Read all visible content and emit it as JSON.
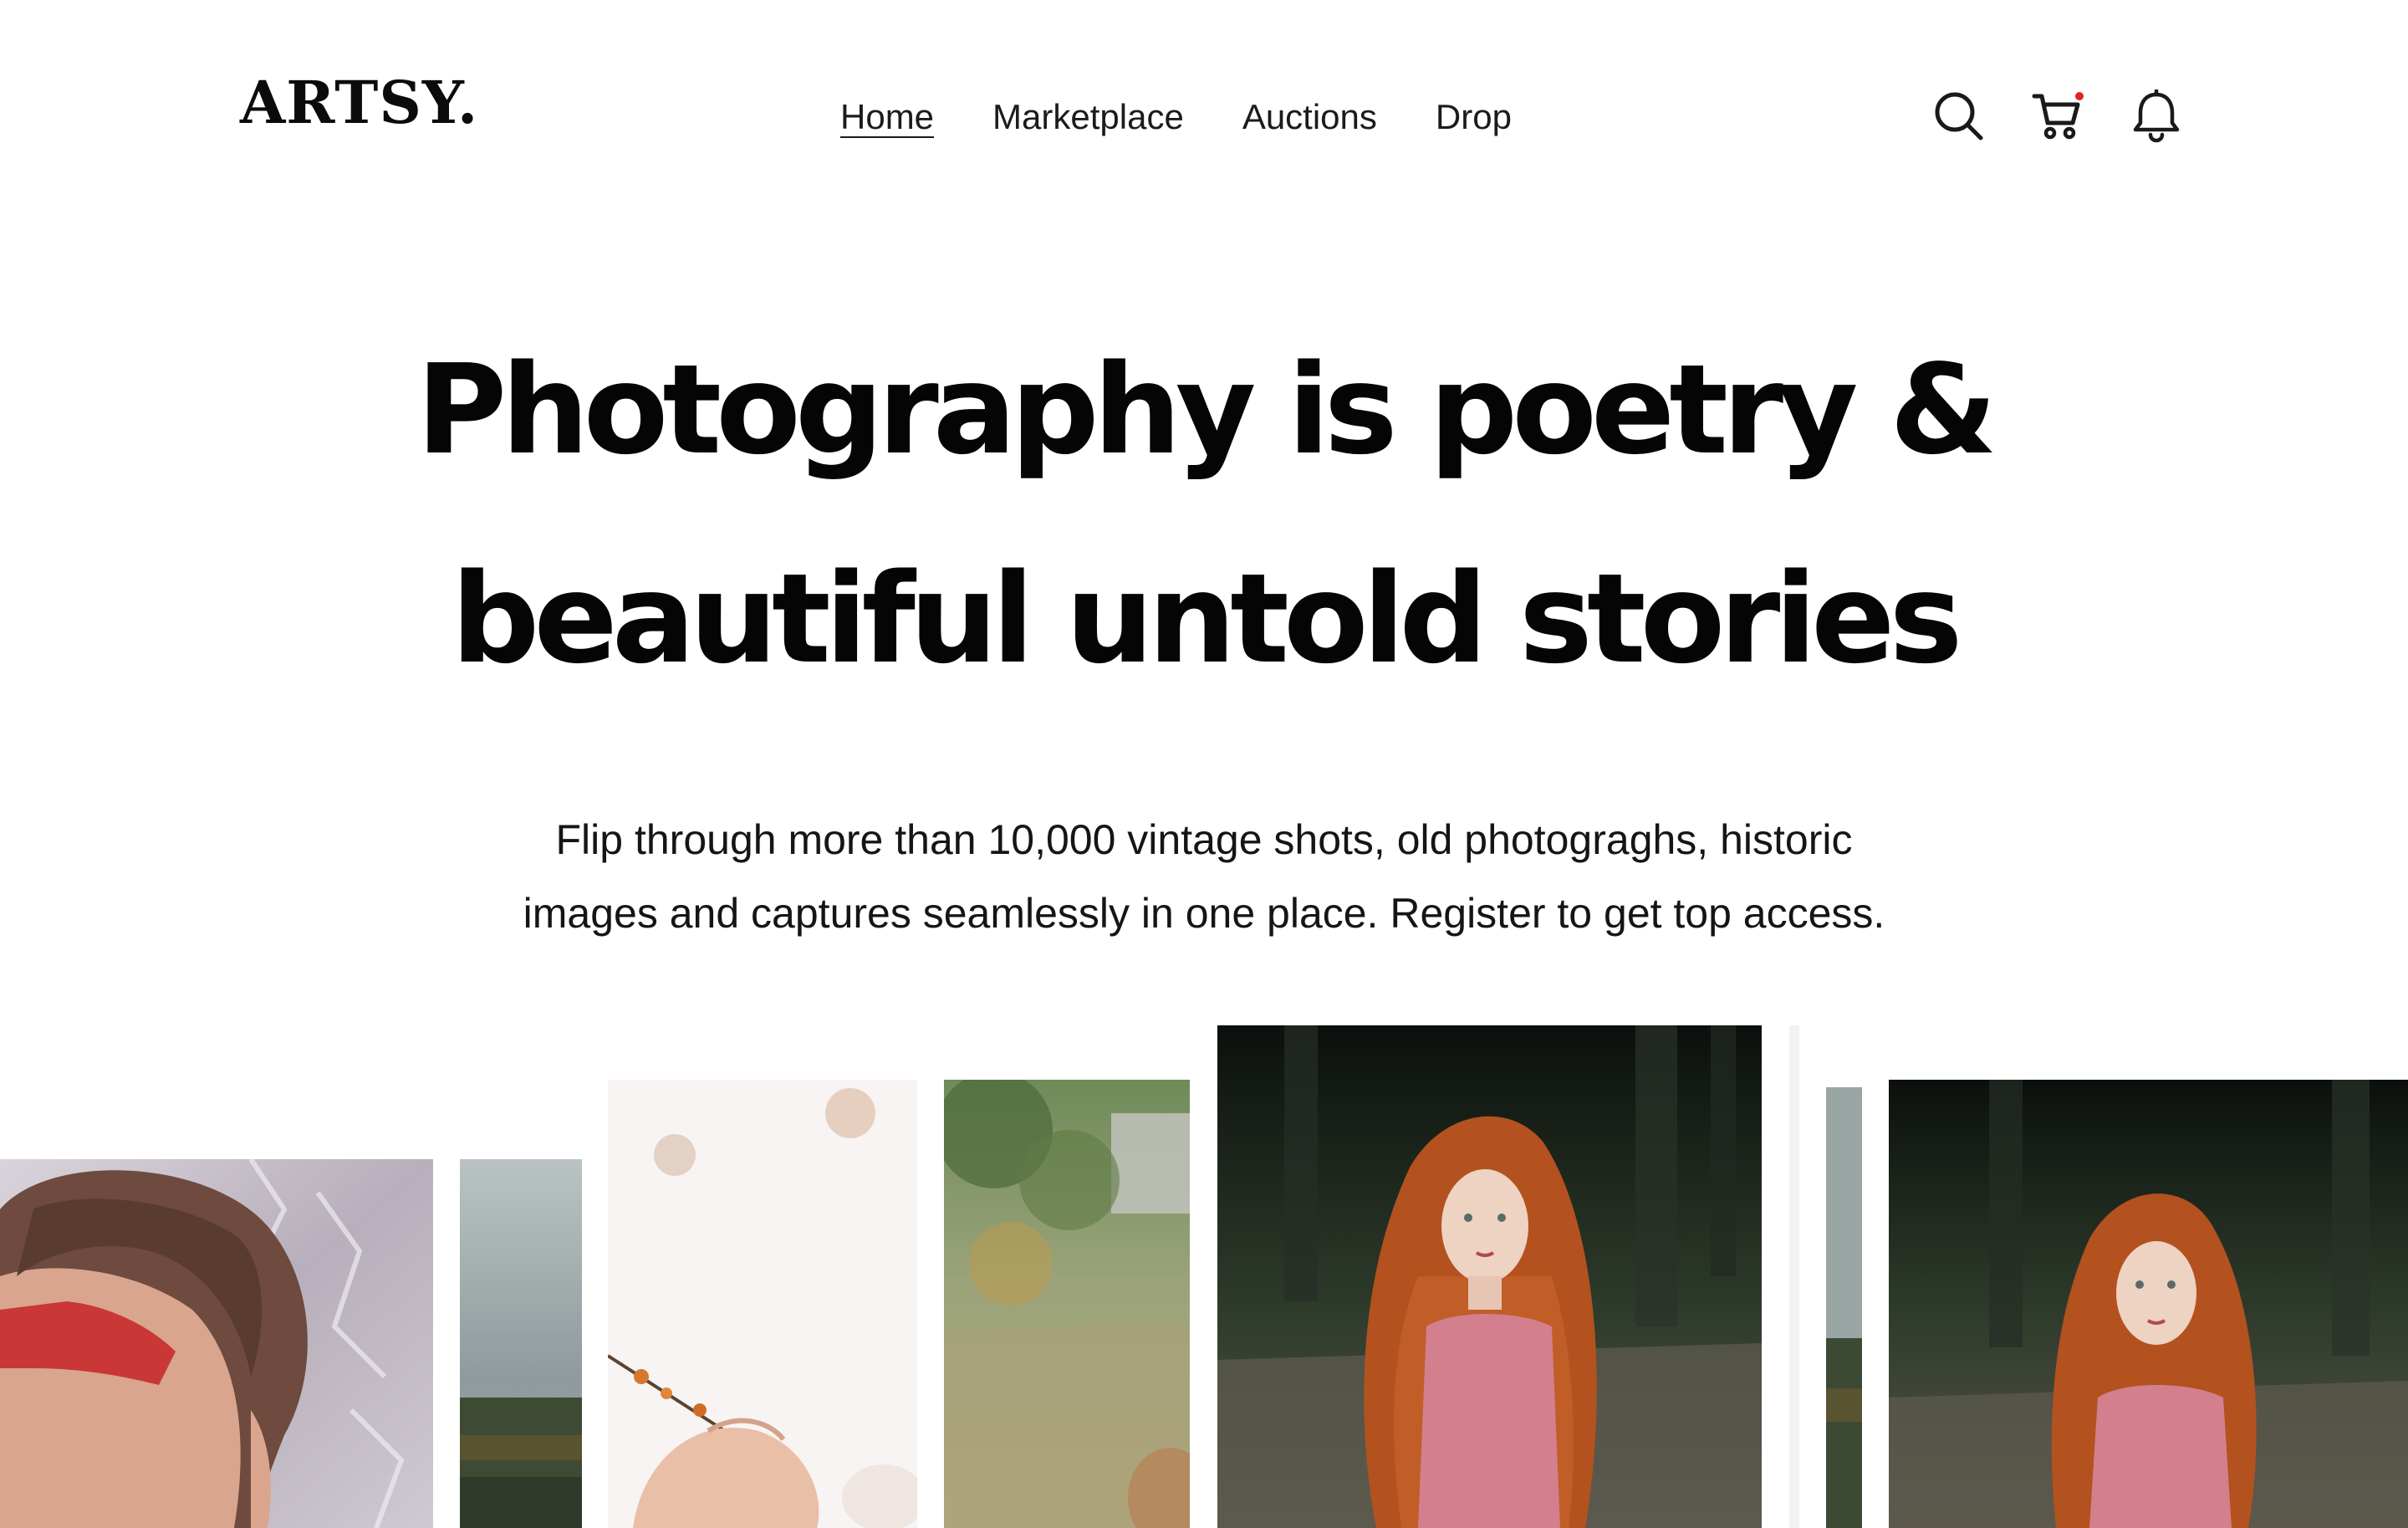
{
  "brand": {
    "logo": "ARTSY."
  },
  "nav": {
    "items": [
      {
        "label": "Home",
        "active": true
      },
      {
        "label": "Marketplace",
        "active": false
      },
      {
        "label": "Auctions",
        "active": false
      },
      {
        "label": "Drop",
        "active": false
      }
    ]
  },
  "header_icons": {
    "search": "search-icon",
    "cart": "cart-icon",
    "notifications": "bell-icon",
    "cart_indicator_color": "#e02424"
  },
  "hero": {
    "title_line1": "Photography is poetry &",
    "title_line2": "beautiful untold stories",
    "subtitle_line1": "Flip through more than 10,000 vintage shots, old photograghs, historic",
    "subtitle_line2": "images and captures seamlessly in one place. Register to get top access."
  },
  "gallery": {
    "images": [
      "boy-red-sunglasses-photo",
      "cloudy-landscape-photo",
      "hand-branch-photo",
      "meadow-photo",
      "red-haired-girl-forest-photo",
      "white-slit-photo",
      "landscape-slit-photo",
      "red-haired-girl-forest-photo-2"
    ]
  },
  "colors": {
    "text": "#0b0b0b",
    "background": "#ffffff",
    "accent_dot": "#e02424"
  }
}
